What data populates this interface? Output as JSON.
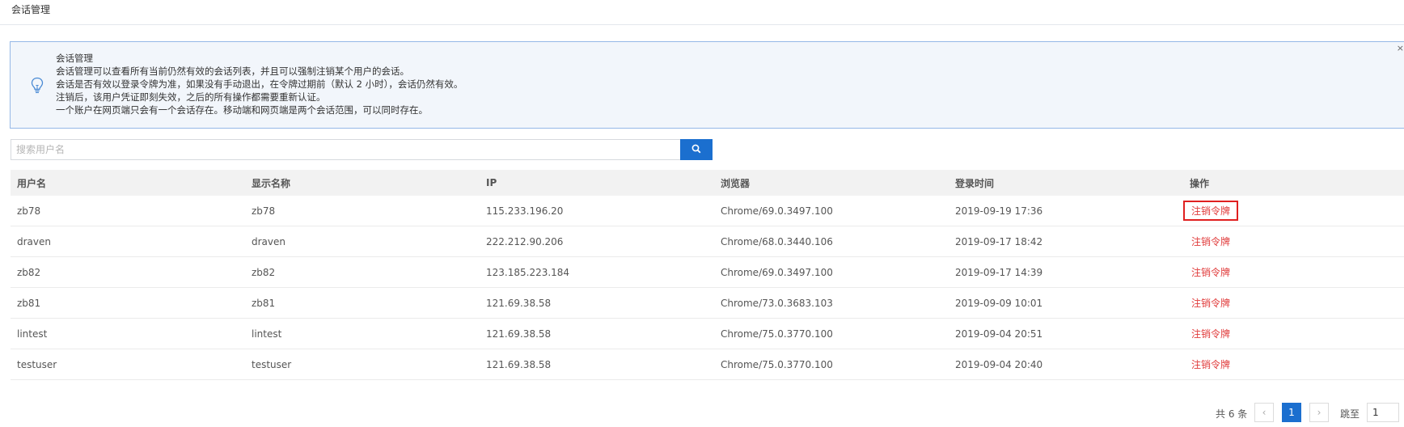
{
  "page": {
    "title": "会话管理"
  },
  "info": {
    "heading": "会话管理",
    "lines": [
      "会话管理可以查看所有当前仍然有效的会话列表，并且可以强制注销某个用户的会话。",
      "会话是否有效以登录令牌为准，如果没有手动退出，在令牌过期前（默认 2 小时），会话仍然有效。",
      "注销后，该用户凭证即刻失效，之后的所有操作都需要重新认证。",
      "一个账户在网页端只会有一个会话存在。移动端和网页端是两个会话范围，可以同时存在。"
    ],
    "close_label": "×"
  },
  "search": {
    "placeholder": "搜索用户名",
    "value": ""
  },
  "table": {
    "columns": [
      "用户名",
      "显示名称",
      "IP",
      "浏览器",
      "登录时间",
      "操作"
    ],
    "rows": [
      {
        "username": "zb78",
        "display_name": "zb78",
        "ip": "115.233.196.20",
        "browser": "Chrome/69.0.3497.100",
        "login_time": "2019-09-19 17:36",
        "action": "注销令牌"
      },
      {
        "username": "draven",
        "display_name": "draven",
        "ip": "222.212.90.206",
        "browser": "Chrome/68.0.3440.106",
        "login_time": "2019-09-17 18:42",
        "action": "注销令牌"
      },
      {
        "username": "zb82",
        "display_name": "zb82",
        "ip": "123.185.223.184",
        "browser": "Chrome/69.0.3497.100",
        "login_time": "2019-09-17 14:39",
        "action": "注销令牌"
      },
      {
        "username": "zb81",
        "display_name": "zb81",
        "ip": "121.69.38.58",
        "browser": "Chrome/73.0.3683.103",
        "login_time": "2019-09-09 10:01",
        "action": "注销令牌"
      },
      {
        "username": "lintest",
        "display_name": "lintest",
        "ip": "121.69.38.58",
        "browser": "Chrome/75.0.3770.100",
        "login_time": "2019-09-04 20:51",
        "action": "注销令牌"
      },
      {
        "username": "testuser",
        "display_name": "testuser",
        "ip": "121.69.38.58",
        "browser": "Chrome/75.0.3770.100",
        "login_time": "2019-09-04 20:40",
        "action": "注销令牌"
      }
    ]
  },
  "pagination": {
    "total_label": "共 6 条",
    "prev_label": "‹",
    "next_label": "›",
    "current_page": "1",
    "jump_label": "跳至",
    "jump_value": "1"
  },
  "colors": {
    "accent": "#1b6fcf",
    "danger": "#e03a3a",
    "info_bg": "#f2f6fb",
    "info_border": "#95b8e7",
    "highlight_box": "#e02020"
  },
  "icons": {
    "info": "lightbulb-icon",
    "search": "search-icon",
    "close": "close-icon",
    "prev": "chevron-left-icon",
    "next": "chevron-right-icon"
  }
}
